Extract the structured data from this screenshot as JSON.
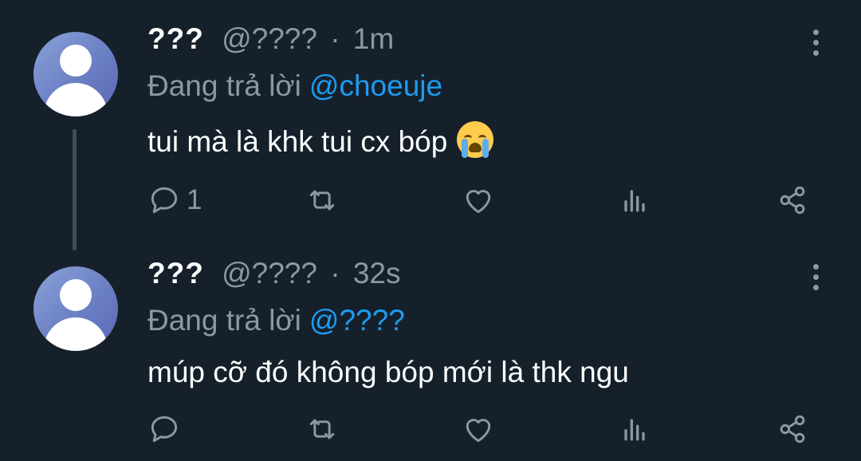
{
  "tweets": [
    {
      "name": "???",
      "handle": "@????",
      "separator": "·",
      "time": "1m",
      "replying_prefix": "Đang trả lời",
      "replying_to": "@choeuje",
      "text": "tui mà là khk tui cx bóp",
      "emoji": "loudly-crying-face",
      "reply_count": "1"
    },
    {
      "name": "???",
      "handle": "@????",
      "separator": "·",
      "time": "32s",
      "replying_prefix": "Đang trả lời",
      "replying_to": "@????",
      "text": "múp cỡ đó không bóp mới là thk ngu",
      "reply_count": ""
    }
  ],
  "icons": {
    "reply": "reply-icon",
    "retweet": "retweet-icon",
    "like": "heart-icon",
    "views": "views-icon",
    "share": "share-icon",
    "more": "more-icon"
  },
  "colors": {
    "background": "#15202b",
    "text": "#ffffff",
    "muted": "#8b98a5",
    "link": "#1d9bf0",
    "thread_line": "#3d4d5c"
  }
}
